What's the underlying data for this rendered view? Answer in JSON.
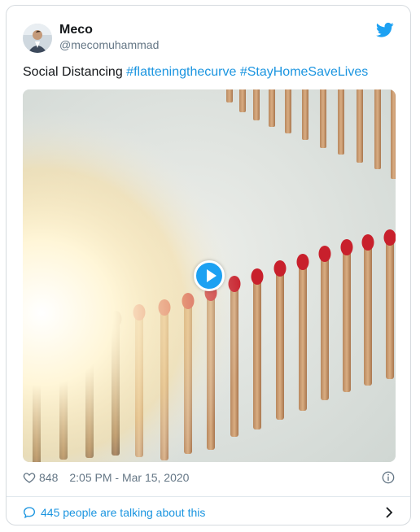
{
  "user": {
    "display_name": "Meco",
    "handle": "@mecomuhammad"
  },
  "tweet": {
    "text_prefix": "Social Distancing ",
    "hashtags": [
      "#flatteningthecurve",
      "#StayHomeSaveLives"
    ]
  },
  "media": {
    "play_icon": "play-icon"
  },
  "meta": {
    "likes": "848",
    "timestamp": "2:05 PM - Mar 15, 2020"
  },
  "footer": {
    "conversation_label": "445 people are talking about this"
  },
  "colors": {
    "accent": "#1b95e0",
    "twitter_blue": "#1da1f2",
    "muted": "#657786",
    "match_head": "#c8202c"
  }
}
